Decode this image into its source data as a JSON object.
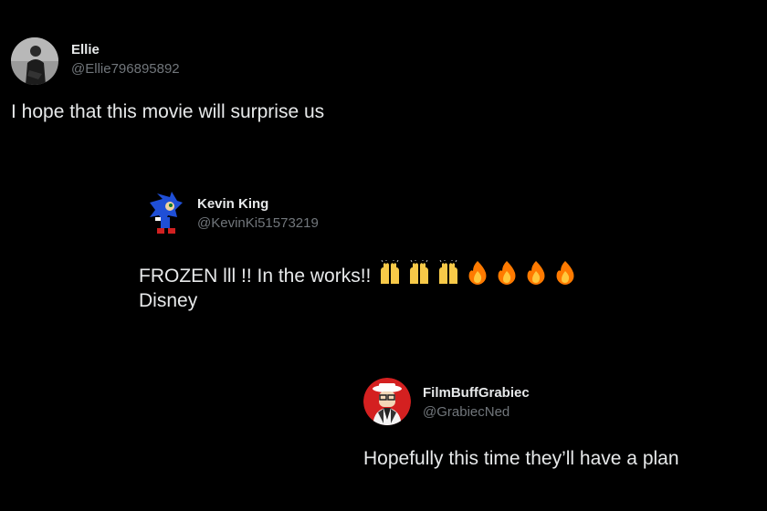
{
  "tweets": [
    {
      "name": "Ellie",
      "handle": "@Ellie796895892",
      "text": "I hope that this movie will surprise us"
    },
    {
      "name": "Kevin King",
      "handle": "@KevinKi51573219",
      "text_line1": "FROZEN lll !! In the works!!",
      "text_line2": "Disney",
      "emojis": [
        "raising-hands",
        "raising-hands",
        "raising-hands",
        "fire",
        "fire",
        "fire",
        "fire"
      ]
    },
    {
      "name": "FilmBuffGrabiec",
      "handle": "@GrabiecNed",
      "text": "Hopefully this time they’ll have a plan"
    }
  ],
  "colors": {
    "background": "#000000",
    "name": "#e7e9ea",
    "handle": "#71767b",
    "fire": "#ff7a00",
    "hands": "#f7c948"
  }
}
